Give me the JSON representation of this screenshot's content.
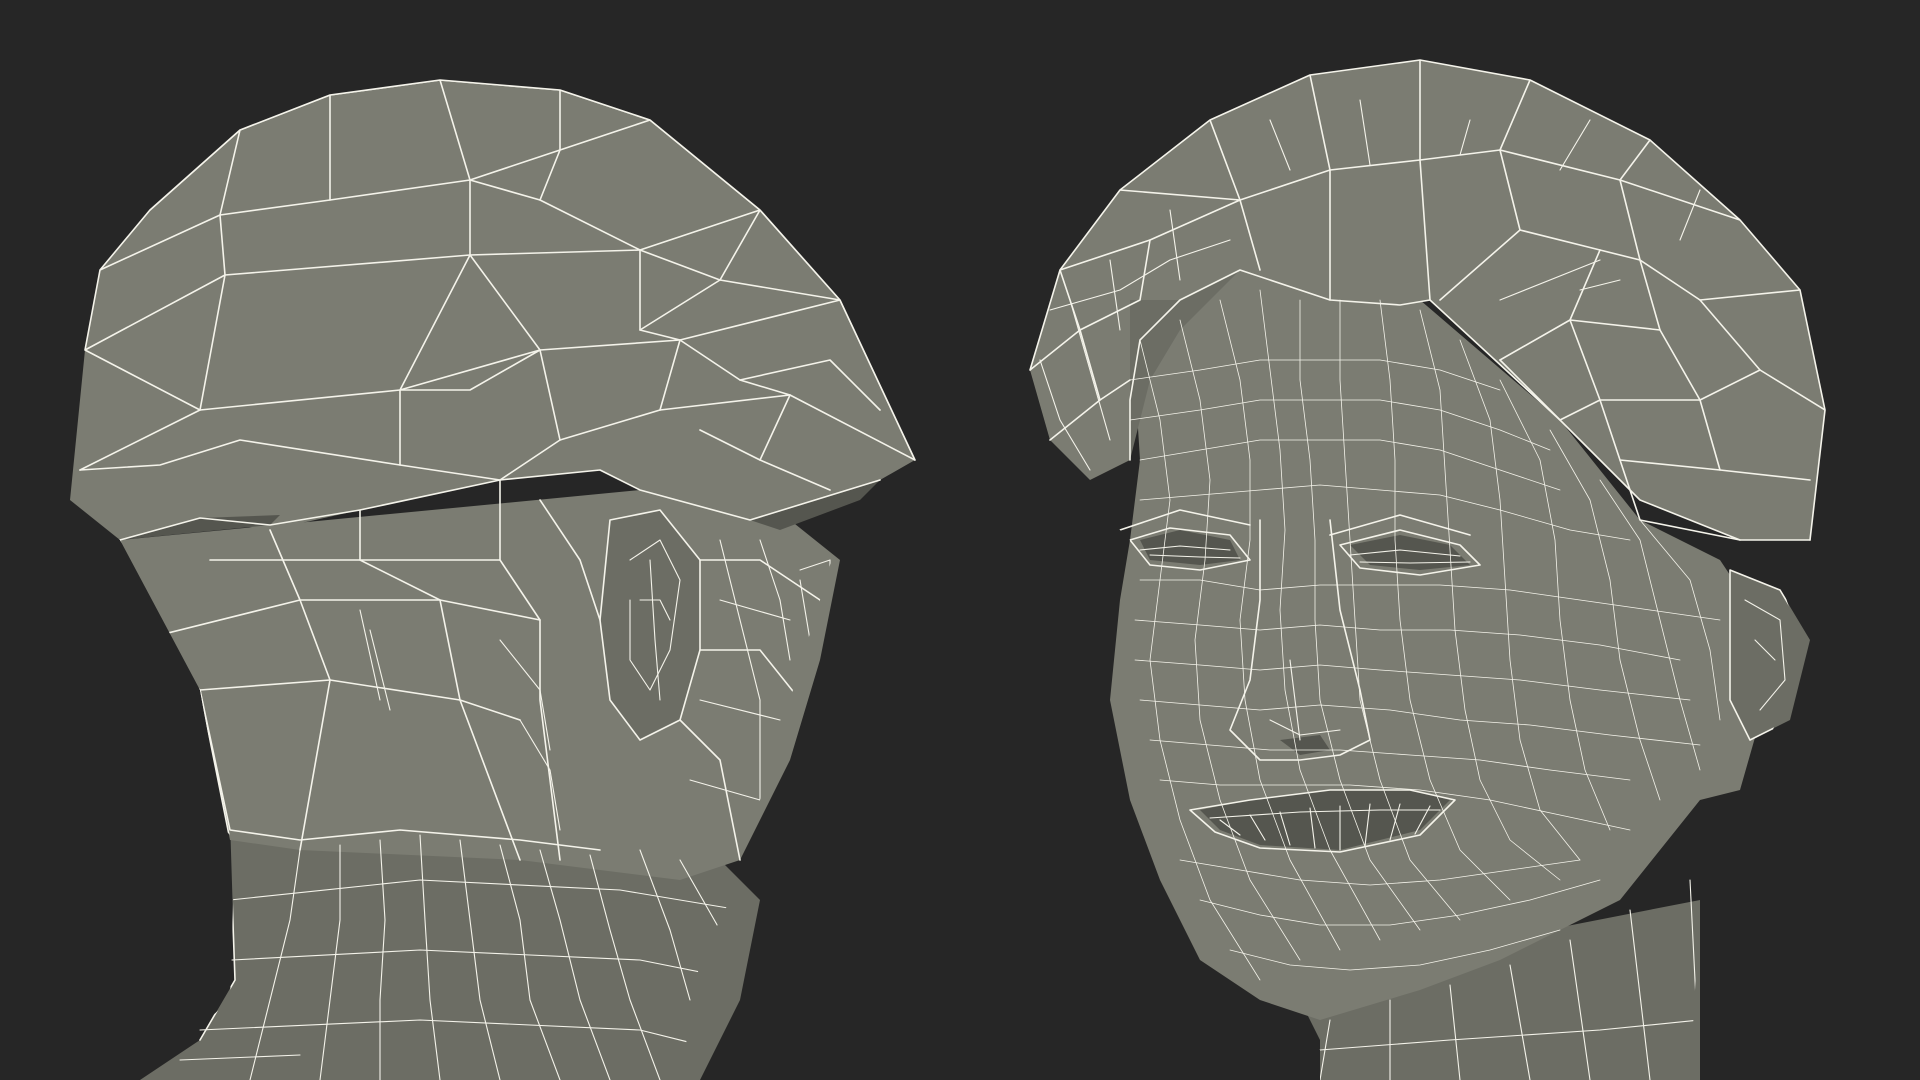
{
  "scene": {
    "background_color": "#262626",
    "mesh_color": "#7b7c72",
    "wire_color": "#f4f3ea",
    "objects": [
      {
        "name": "head-side-view",
        "view": "profile"
      },
      {
        "name": "head-front-view",
        "view": "three-quarter"
      }
    ]
  }
}
